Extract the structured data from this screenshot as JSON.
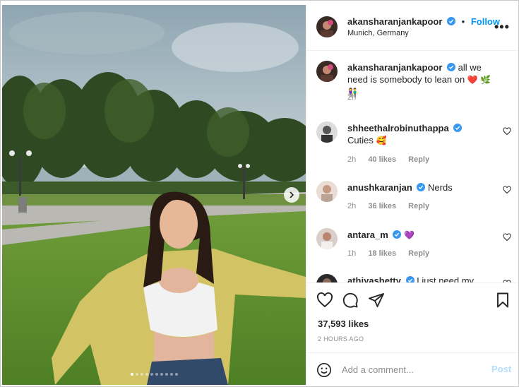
{
  "post": {
    "username": "akansharanjankapoor",
    "separator": "•",
    "follow_label": "Follow",
    "location": "Munich, Germany",
    "more_label": "•••",
    "carousel": {
      "slide_count": 10,
      "active_index": 0
    }
  },
  "caption": {
    "username": "akansharanjankapoor",
    "text": "all we need is somebody to lean on",
    "emojis": "❤️ 🌿 👫",
    "time": "2h"
  },
  "comments": [
    {
      "username": "shheethalrobinuthappa",
      "text": "Cuties",
      "emoji": "🥰",
      "time": "2h",
      "likes": "40 likes",
      "reply": "Reply"
    },
    {
      "username": "anushkaranjan",
      "text": "Nerds",
      "emoji": "",
      "time": "2h",
      "likes": "36 likes",
      "reply": "Reply"
    },
    {
      "username": "antara_m",
      "text": "",
      "emoji": "💜",
      "time": "1h",
      "likes": "18 likes",
      "reply": "Reply"
    },
    {
      "username": "athiyashetty",
      "text": "I just need my",
      "emoji": "",
      "time": "",
      "likes": "",
      "reply": ""
    }
  ],
  "stats": {
    "likes": "37,593 likes",
    "posted": "2 HOURS AGO"
  },
  "add_comment": {
    "placeholder": "Add a comment...",
    "post_label": "Post"
  },
  "colors": {
    "accent": "#0095f6",
    "verified": "#3897f0",
    "muted": "#8e8e8e",
    "post_disabled": "#b2dffc"
  },
  "icons": {
    "like": "heart-icon",
    "comment": "comment-icon",
    "share": "paper-plane-icon",
    "save": "bookmark-icon",
    "emoji": "smiley-icon",
    "next": "chevron-right-icon"
  }
}
